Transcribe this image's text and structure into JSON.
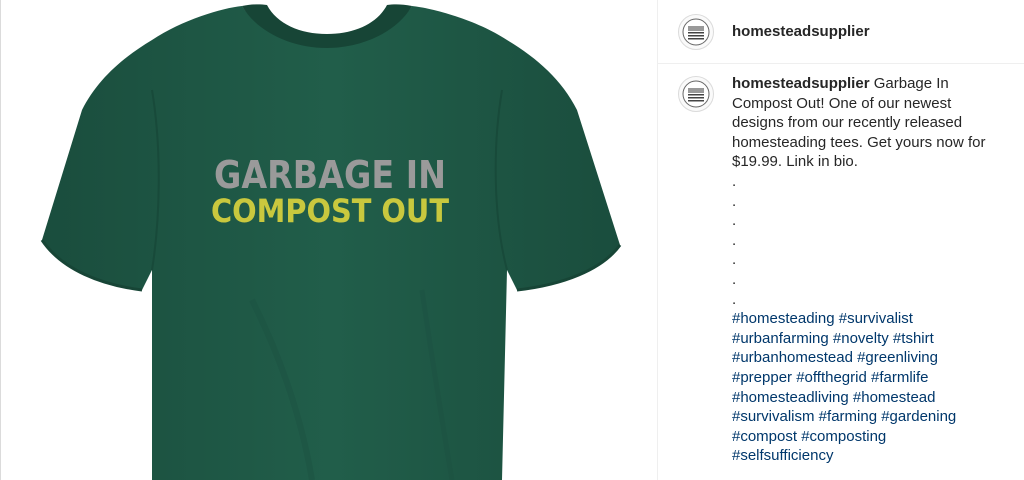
{
  "post": {
    "username": "homesteadsupplier",
    "caption": "Garbage In Compost Out! One of our newest designs from our recently released homesteading tees. Get yours now for $19.99. Link in bio.",
    "dots": [
      ".",
      ".",
      ".",
      ".",
      ".",
      ".",
      "."
    ],
    "hashtags": [
      "#homesteading #survivalist",
      "#urbanfarming #novelty #tshirt",
      "#urbanhomestead #greenliving",
      "#prepper #offthegrid #farmlife",
      "#homesteadliving #homestead",
      "#survivalism #farming #gardening",
      "#compost #composting",
      "#selfsufficiency"
    ]
  },
  "image": {
    "shirt_line1": "GARBAGE IN",
    "shirt_line2": "COMPOST OUT"
  },
  "colors": {
    "shirt": "#1f5a47",
    "text_gray": "#9a9a9a",
    "text_yellow": "#c9c83e",
    "hashtag": "#00376b"
  }
}
